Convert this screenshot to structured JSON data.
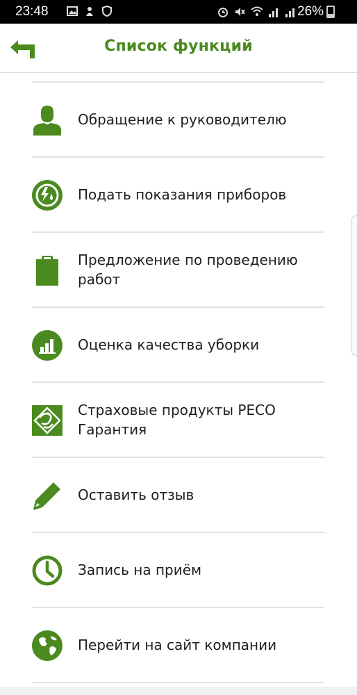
{
  "status": {
    "time": "23:48",
    "battery": "26%"
  },
  "header": {
    "title": "Список функций"
  },
  "menu": [
    {
      "label": "Обращение к руководителю",
      "icon": "person-icon"
    },
    {
      "label": "Подать показания приборов",
      "icon": "utility-meter-icon"
    },
    {
      "label": "Предложение по проведению работ",
      "icon": "clipboard-icon"
    },
    {
      "label": "Оценка качества уборки",
      "icon": "bar-chart-icon"
    },
    {
      "label": "Страховые продукты РЕСО Гарантия",
      "icon": "reso-logo-icon"
    },
    {
      "label": "Оставить отзыв",
      "icon": "pencil-icon"
    },
    {
      "label": "Запись на приём",
      "icon": "clock-icon"
    },
    {
      "label": "Перейти на сайт компании",
      "icon": "globe-icon"
    }
  ],
  "colors": {
    "accent": "#4a8a1f",
    "divider": "#e1e1e1",
    "text": "#1e1e1e"
  }
}
